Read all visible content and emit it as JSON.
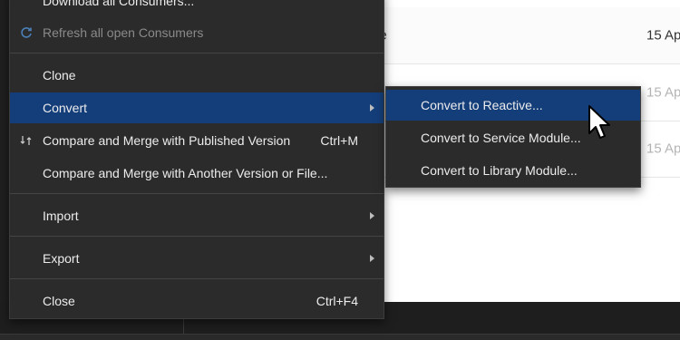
{
  "menu": {
    "items": {
      "download_all": "Download all Consumers...",
      "refresh": "Refresh all open Consumers",
      "clone": "Clone",
      "convert": "Convert",
      "compare_published": "Compare and Merge with Published Version",
      "compare_published_shortcut": "Ctrl+M",
      "compare_another": "Compare and Merge with Another Version or File...",
      "import": "Import",
      "export": "Export",
      "close": "Close",
      "close_shortcut": "Ctrl+F4"
    }
  },
  "submenu": {
    "items": [
      "Convert to Reactive...",
      "Convert to Service Module...",
      "Convert to Library Module..."
    ]
  },
  "background_list": {
    "rows": [
      {
        "name": "ne",
        "date": "15 Ap"
      },
      {
        "name": "",
        "date": "15 Ap"
      },
      {
        "name": "",
        "date": "15 Ap"
      }
    ]
  },
  "colors": {
    "menu_bg": "#2b2b2b",
    "highlight": "#143e7a",
    "text": "#ececec",
    "disabled_text": "#8a8a8a"
  }
}
